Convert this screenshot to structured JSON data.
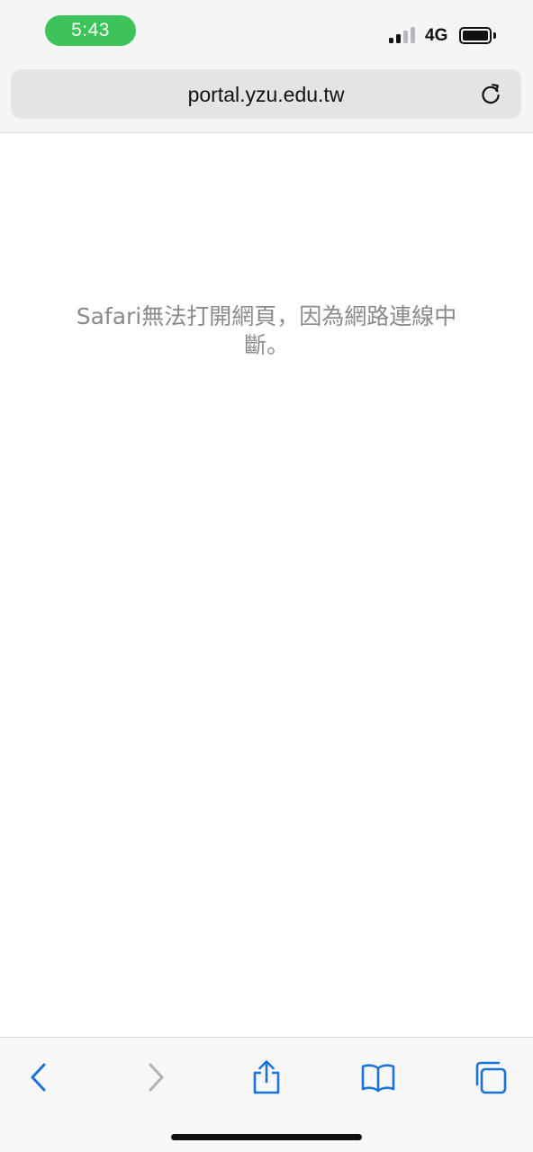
{
  "status_bar": {
    "time": "5:43",
    "network": "4G",
    "signal_bars_active": 2,
    "signal_bars_total": 4,
    "time_pill_color": "#3cc45a"
  },
  "address_bar": {
    "url": "portal.yzu.edu.tw",
    "reload_icon": "reload-icon"
  },
  "content": {
    "error_message": "Safari無法打開網頁，因為網路連線中斷。"
  },
  "toolbar": {
    "accent_color": "#1a73d9",
    "disabled_color": "#b0b0b5",
    "items": [
      {
        "name": "back-icon",
        "enabled": true
      },
      {
        "name": "forward-icon",
        "enabled": false
      },
      {
        "name": "share-icon",
        "enabled": true
      },
      {
        "name": "bookmarks-icon",
        "enabled": true
      },
      {
        "name": "tabs-icon",
        "enabled": true
      }
    ]
  }
}
